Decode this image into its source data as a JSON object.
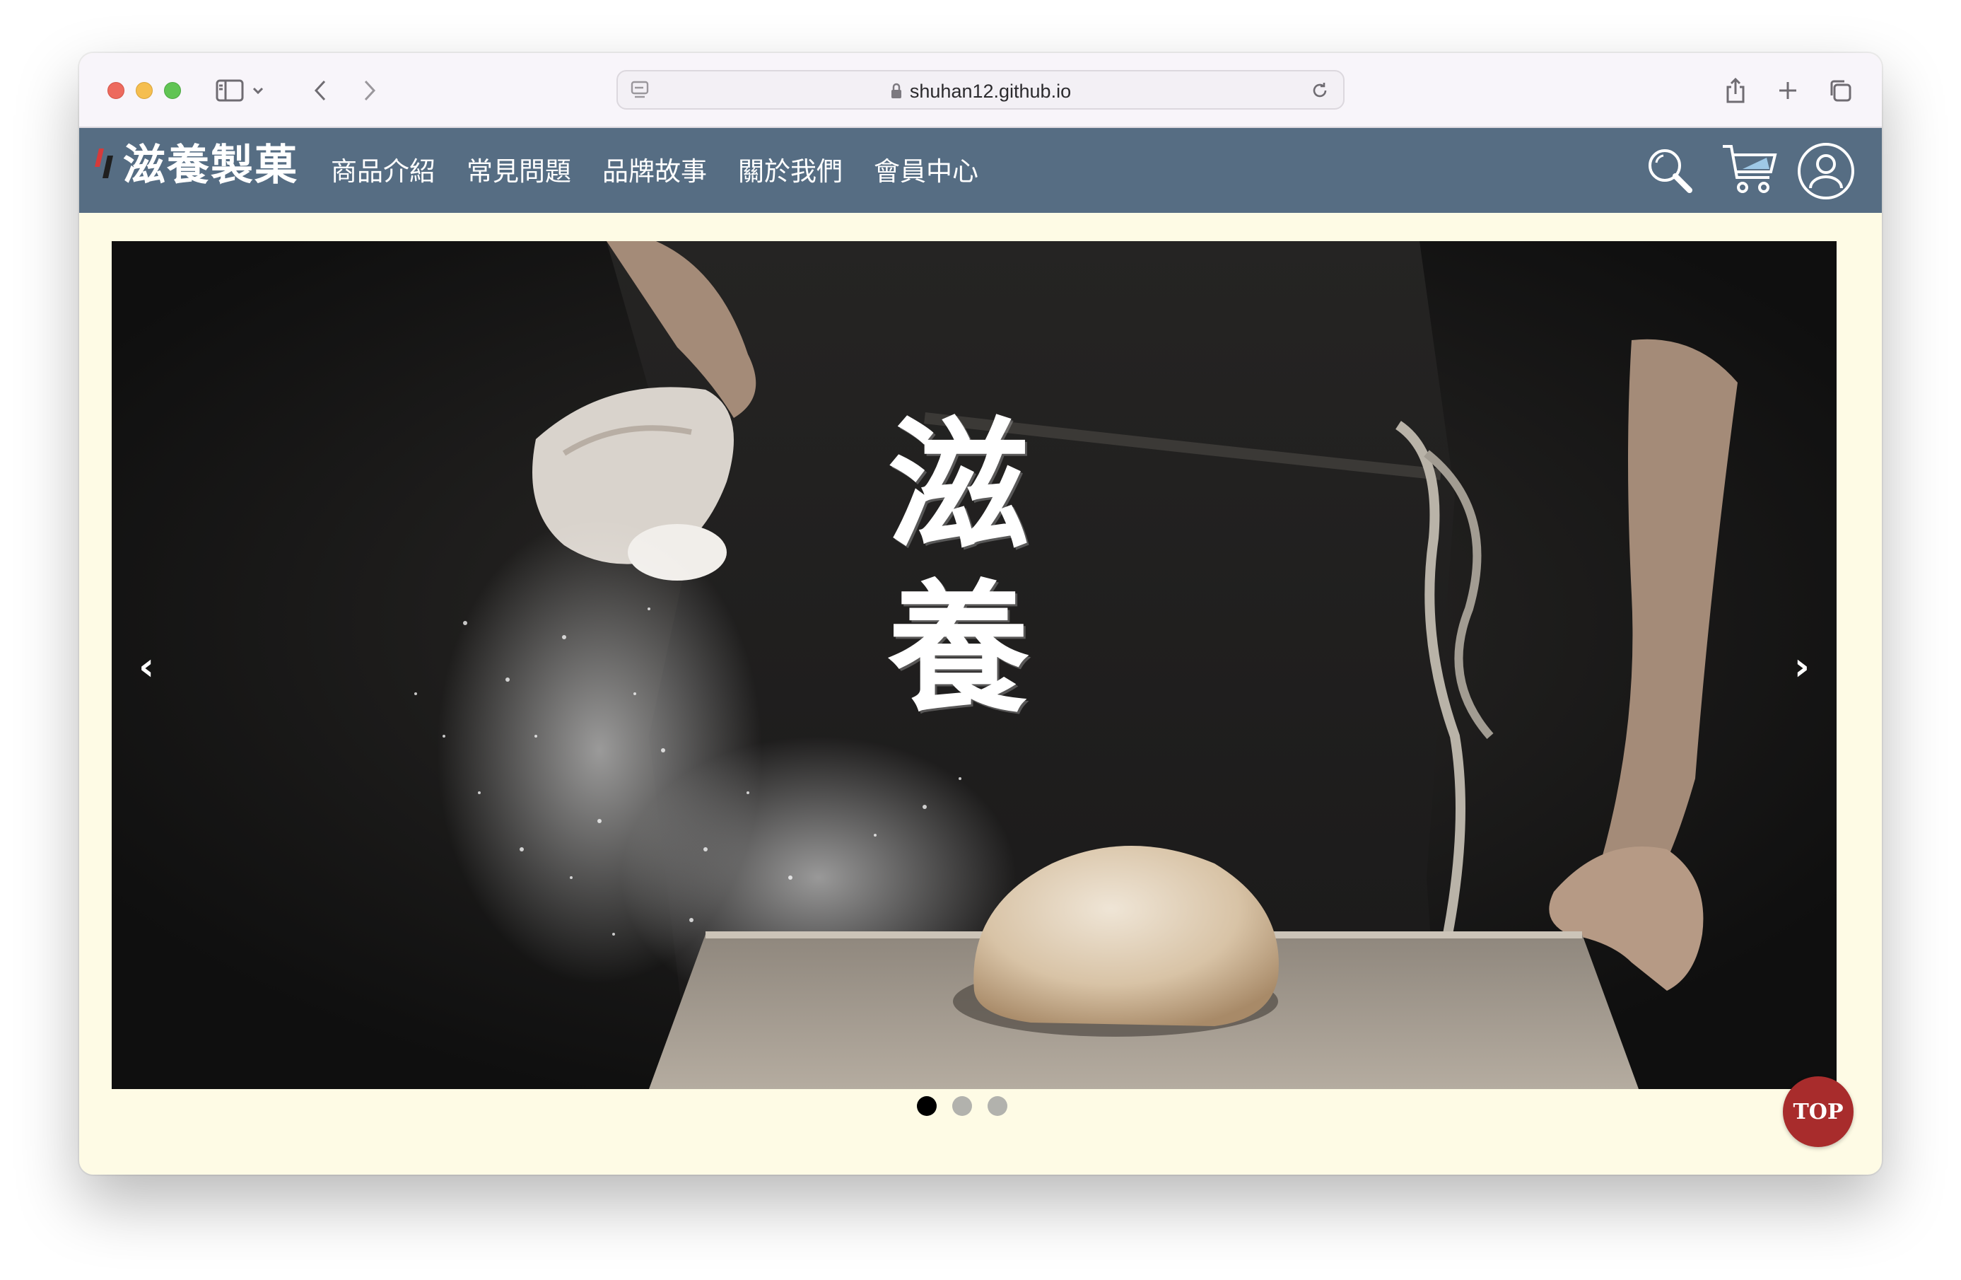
{
  "browser": {
    "url": "shuhan12.github.io"
  },
  "site": {
    "logo_text": "滋養製菓",
    "nav": [
      {
        "label": "商品介紹"
      },
      {
        "label": "常見問題"
      },
      {
        "label": "品牌故事"
      },
      {
        "label": "關於我們"
      },
      {
        "label": "會員中心"
      }
    ],
    "header_color": "#566d83",
    "page_background": "#fefbe5"
  },
  "hero": {
    "title": "滋養",
    "prev_label": "‹",
    "next_label": "›",
    "slide_count": 3,
    "active_slide": 1
  },
  "top_button": {
    "label": "TOP",
    "color": "#a82c2c"
  },
  "icons": [
    "sidebar-icon",
    "chevron-down-icon",
    "back-icon",
    "forward-icon",
    "site-settings-icon",
    "lock-icon",
    "reload-icon",
    "share-icon",
    "plus-icon",
    "tabs-icon",
    "search-icon",
    "cart-icon",
    "user-icon"
  ]
}
